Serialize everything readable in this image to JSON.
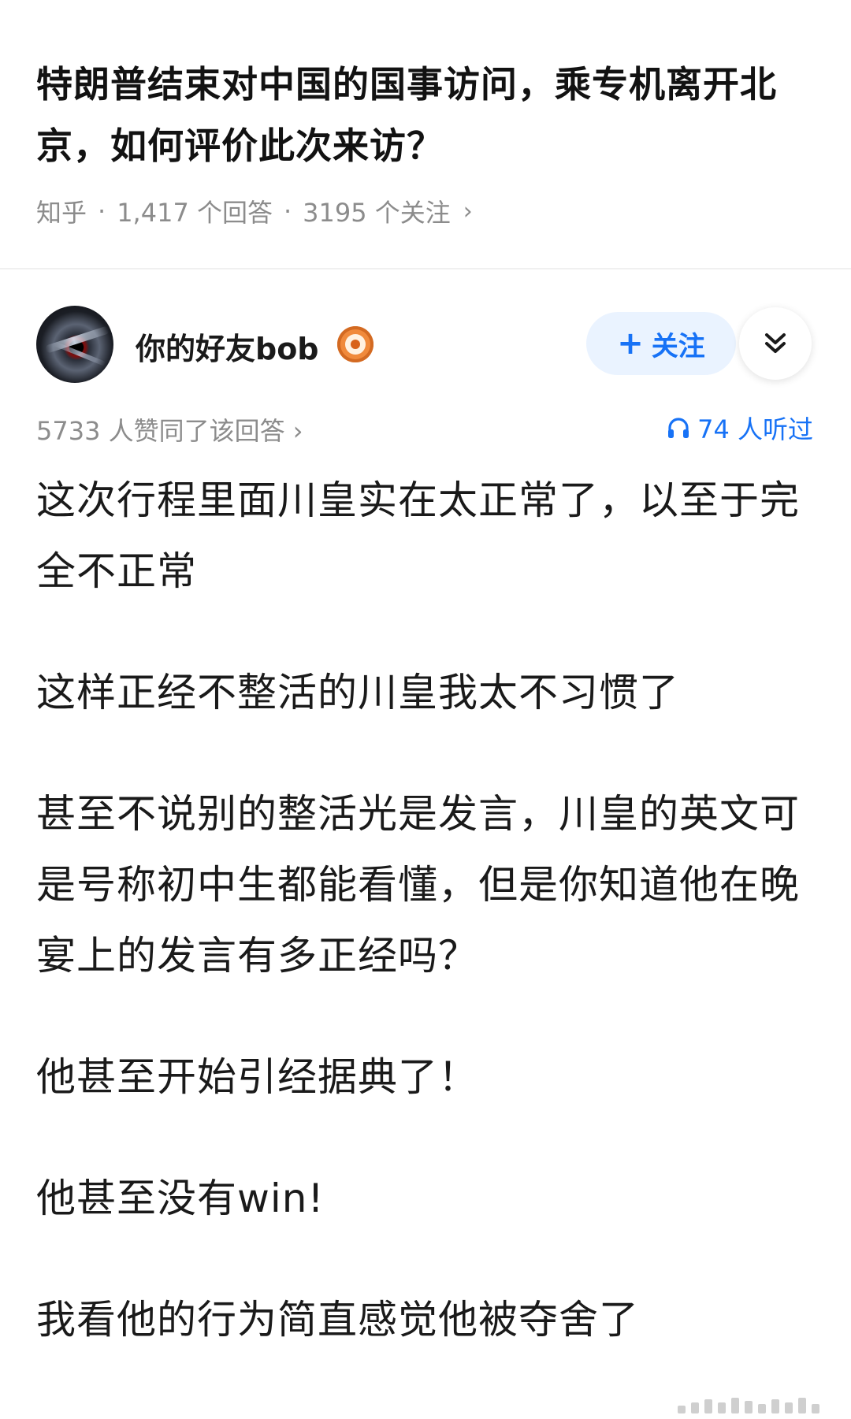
{
  "question": {
    "title": "特朗普结束对中国的国事访问，乘专机离开北京，如何评价此次来访？",
    "source": "知乎",
    "answers": "1,417 个回答",
    "followers": "3195 个关注"
  },
  "author": {
    "name": "你的好友bob",
    "follow_label": "关注"
  },
  "stats": {
    "votes": "5733 人赞同了该回答",
    "listen": "74 人听过"
  },
  "answer": {
    "paragraphs": [
      "这次行程里面川皇实在太正常了，以至于完全不正常",
      "这样正经不整活的川皇我太不习惯了",
      "甚至不说别的整活光是发言，川皇的英文可是号称初中生都能看懂，但是你知道他在晚宴上的发言有多正经吗？",
      "他甚至开始引经据典了！",
      "他甚至没有win!",
      "我看他的行为简直感觉他被夺舍了"
    ]
  },
  "colors": {
    "accent": "#1772f6",
    "follow_bg": "#eaf3ff",
    "meta": "#8c8c8c"
  }
}
